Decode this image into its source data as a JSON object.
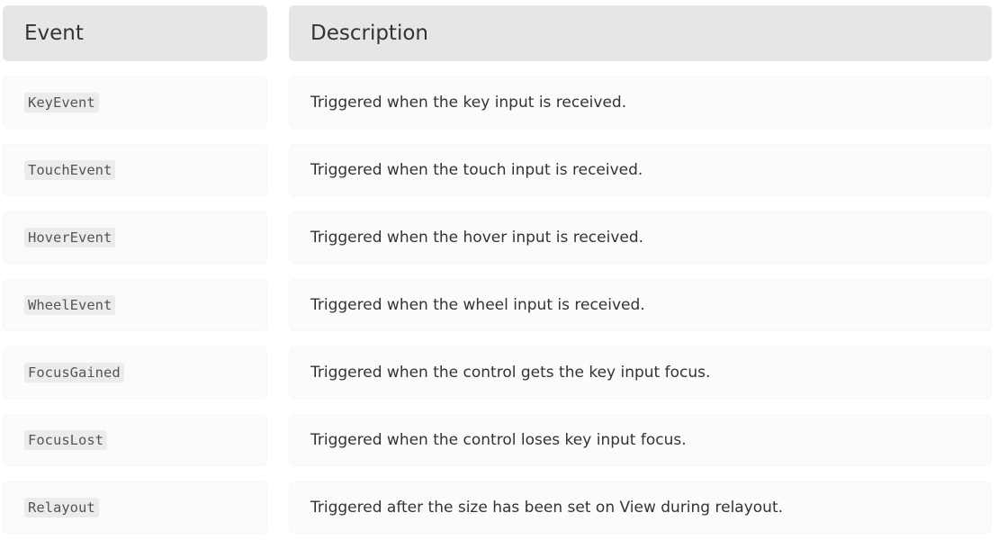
{
  "table": {
    "headers": {
      "event": "Event",
      "description": "Description"
    },
    "rows": [
      {
        "event": "KeyEvent",
        "description": "Triggered when the key input is received."
      },
      {
        "event": "TouchEvent",
        "description": "Triggered when the touch input is received."
      },
      {
        "event": "HoverEvent",
        "description": "Triggered when the hover input is received."
      },
      {
        "event": "WheelEvent",
        "description": "Triggered when the wheel input is received."
      },
      {
        "event": "FocusGained",
        "description": "Triggered when the control gets the key input focus."
      },
      {
        "event": "FocusLost",
        "description": "Triggered when the control loses key input focus."
      },
      {
        "event": "Relayout",
        "description": "Triggered after the size has been set on View during relayout."
      }
    ]
  }
}
